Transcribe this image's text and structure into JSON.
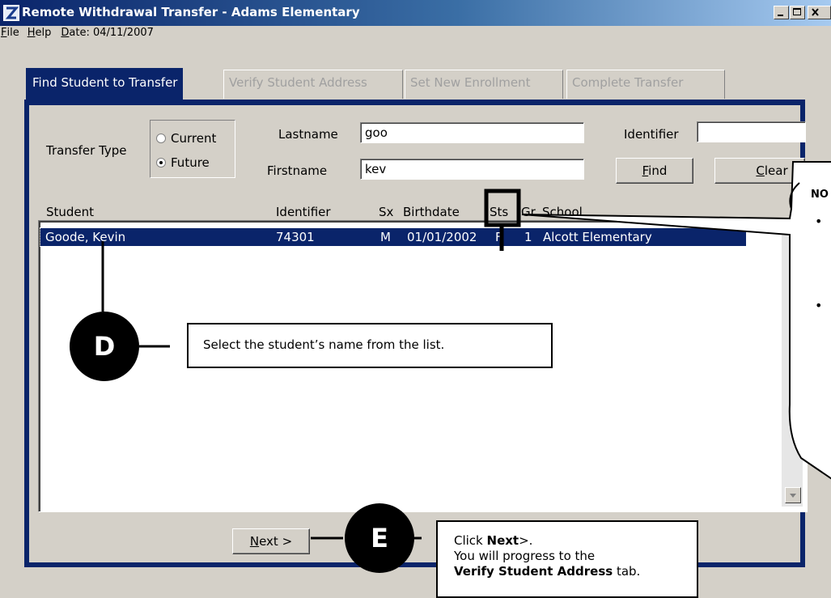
{
  "window": {
    "title": "Remote Withdrawal Transfer - Adams Elementary"
  },
  "menu": {
    "file_prefix": "F",
    "file_rest": "ile",
    "help_prefix": "H",
    "help_rest": "elp",
    "date_prefix": "D",
    "date_rest": "ate: 04/11/2007"
  },
  "tabs": [
    {
      "label": "Find Student to Transfer",
      "active": true
    },
    {
      "label": "Verify Student Address",
      "active": false
    },
    {
      "label": "Set New Enrollment",
      "active": false
    },
    {
      "label": "Complete Transfer",
      "active": false
    }
  ],
  "form": {
    "transfer_type_label": "Transfer Type",
    "radio_current": "Current",
    "radio_future": "Future",
    "selected_radio": "Future",
    "lastname_label": "Lastname",
    "lastname_value": "goo",
    "firstname_label": "Firstname",
    "firstname_value": "kev",
    "identifier_label": "Identifier",
    "identifier_value": "",
    "find_prefix": "F",
    "find_rest": "ind",
    "clear_prefix": "C",
    "clear_rest": "lear"
  },
  "list": {
    "columns": [
      "Student",
      "Identifier",
      "Sx",
      "Birthdate",
      "Sts",
      "Gr",
      "School"
    ],
    "rows": [
      {
        "student": "Goode, Kevin",
        "identifier": "74301",
        "sx": "M",
        "birthdate": "01/01/2002",
        "sts": "F",
        "gr": "1",
        "school": "Alcott Elementary"
      }
    ]
  },
  "footer": {
    "next_prefix": "N",
    "next_rest": "ext >"
  },
  "callouts": {
    "d_badge": "D",
    "d_text": "Select the student’s name from the list.",
    "e_badge": "E",
    "e_line1_a": "Click ",
    "e_line1_b": "Next",
    "e_line1_c": ">.",
    "e_line2": "You will progress to the",
    "e_line3_b": "Verify Student Address",
    "e_line3_c": " tab.",
    "note_title": "NO",
    "note_bullet": "•"
  },
  "colors": {
    "selection": "#0a246a",
    "panel_border": "#0a246a",
    "window_bg": "#d4d0c8"
  }
}
